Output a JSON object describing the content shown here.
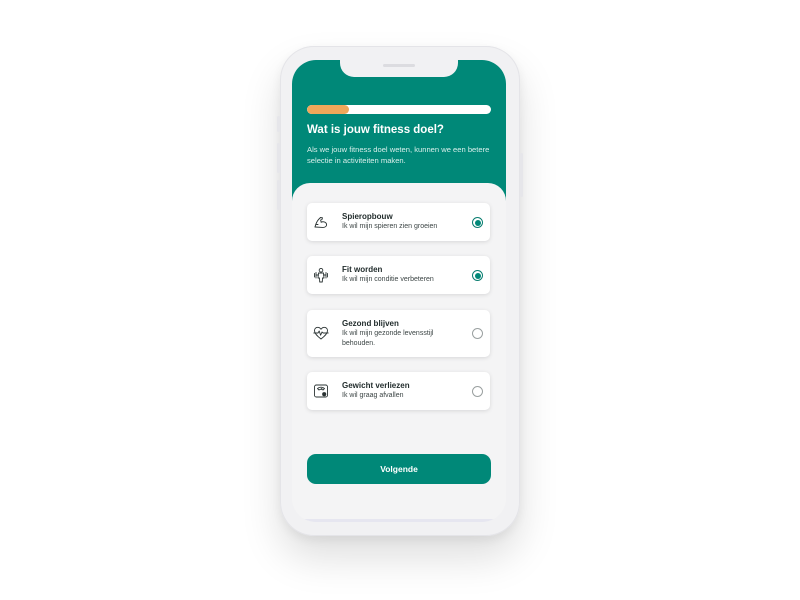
{
  "progress": {
    "fraction": 0.23,
    "track_color": "#ffffff",
    "fill_color": "#f0a75a"
  },
  "header": {
    "title": "Wat is jouw fitness doel?",
    "subtitle": "Als we jouw fitness doel weten, kunnen we een betere selectie in activiteiten maken.",
    "background": "#008878"
  },
  "options": [
    {
      "icon": "flexed-arm-icon",
      "title": "Spieropbouw",
      "description": "Ik wil mijn spieren zien groeien",
      "checked": true
    },
    {
      "icon": "fitness-person-icon",
      "title": "Fit worden",
      "description": "Ik wil mijn conditie verbeteren",
      "checked": true
    },
    {
      "icon": "heart-pulse-icon",
      "title": "Gezond blijven",
      "description": "Ik wil mijn gezonde levensstijl behouden.",
      "checked": false
    },
    {
      "icon": "scale-icon",
      "title": "Gewicht verliezen",
      "description": "Ik wil graag afvallen",
      "checked": false
    }
  ],
  "actions": {
    "next_label": "Volgende"
  },
  "colors": {
    "primary": "#008878",
    "accent": "#f0a75a",
    "background": "#f4f4f5"
  }
}
